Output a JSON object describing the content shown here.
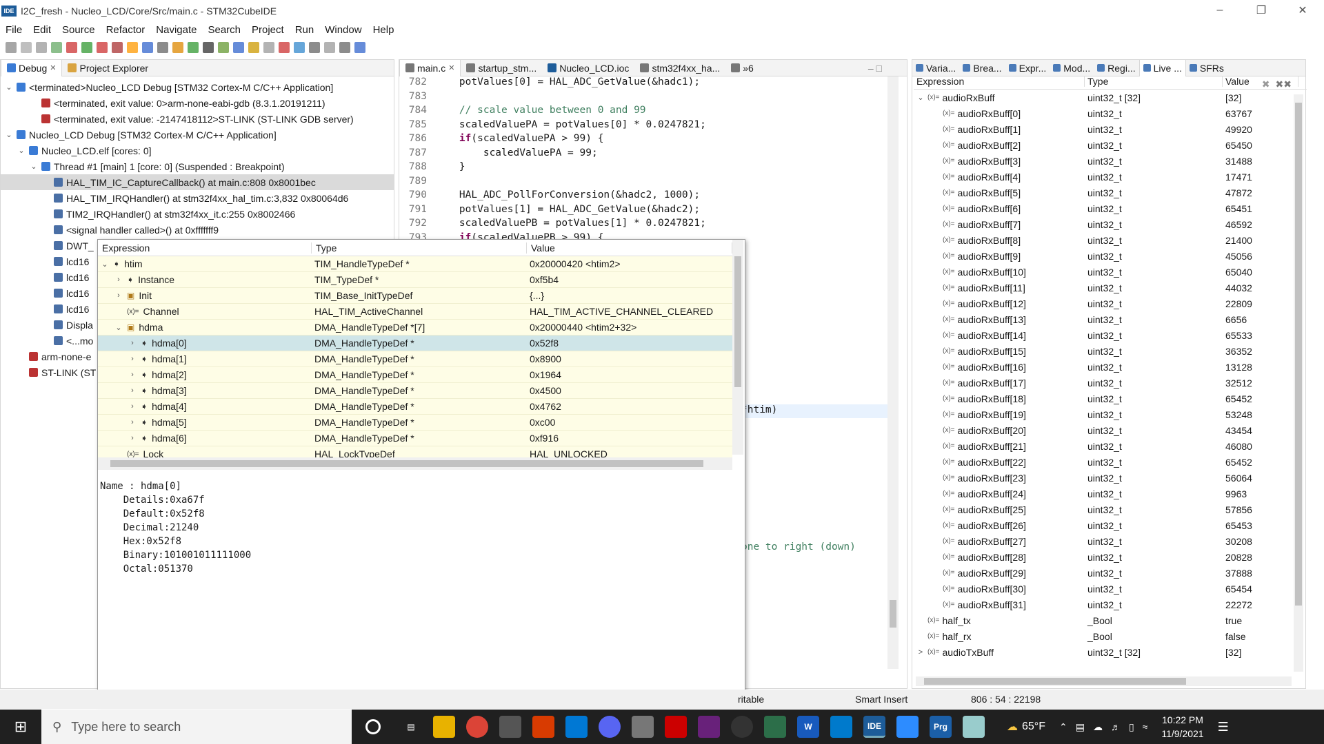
{
  "window": {
    "title": "I2C_fresh - Nucleo_LCD/Core/Src/main.c - STM32CubeIDE",
    "app_icon": "IDE"
  },
  "menu": [
    "File",
    "Edit",
    "Source",
    "Refactor",
    "Navigate",
    "Search",
    "Project",
    "Run",
    "Window",
    "Help"
  ],
  "debug_view": {
    "tabs": [
      "Debug",
      "Project Explorer"
    ],
    "rows": [
      {
        "text": "<terminated>Nucleo_LCD Debug [STM32 Cortex-M C/C++ Application]",
        "indent": 0,
        "caret": "v"
      },
      {
        "text": "<terminated, exit value: 0>arm-none-eabi-gdb (8.3.1.20191211)",
        "indent": 2,
        "caret": ""
      },
      {
        "text": "<terminated, exit value: -2147418112>ST-LINK (ST-LINK GDB server)",
        "indent": 2,
        "caret": ""
      },
      {
        "text": "Nucleo_LCD Debug [STM32 Cortex-M C/C++ Application]",
        "indent": 0,
        "caret": "v"
      },
      {
        "text": "Nucleo_LCD.elf [cores: 0]",
        "indent": 1,
        "caret": "v"
      },
      {
        "text": "Thread #1 [main] 1 [core: 0] (Suspended : Breakpoint)",
        "indent": 2,
        "caret": "v"
      },
      {
        "text": "HAL_TIM_IC_CaptureCallback() at main.c:808 0x8001bec",
        "indent": 3,
        "caret": "",
        "selected": true
      },
      {
        "text": "HAL_TIM_IRQHandler() at stm32f4xx_hal_tim.c:3,832 0x80064d6",
        "indent": 3,
        "caret": ""
      },
      {
        "text": "TIM2_IRQHandler() at stm32f4xx_it.c:255 0x8002466",
        "indent": 3,
        "caret": ""
      },
      {
        "text": "<signal handler called>() at 0xfffffff9",
        "indent": 3,
        "caret": ""
      },
      {
        "text": "DWT_",
        "indent": 3,
        "caret": ""
      },
      {
        "text": "lcd16",
        "indent": 3,
        "caret": ""
      },
      {
        "text": "lcd16",
        "indent": 3,
        "caret": ""
      },
      {
        "text": "lcd16",
        "indent": 3,
        "caret": ""
      },
      {
        "text": "lcd16",
        "indent": 3,
        "caret": ""
      },
      {
        "text": "Displa",
        "indent": 3,
        "caret": ""
      },
      {
        "text": "<...mo",
        "indent": 3,
        "caret": ""
      },
      {
        "text": "arm-none-e",
        "indent": 1,
        "caret": ""
      },
      {
        "text": "ST-LINK (ST",
        "indent": 1,
        "caret": ""
      }
    ]
  },
  "editor": {
    "tabs": [
      "main.c",
      "startup_stm...",
      "Nucleo_LCD.ioc",
      "stm32f4xx_ha...",
      "»6"
    ],
    "lines": [
      {
        "n": "782",
        "t": "    potValues[0] = HAL_ADC_GetValue(&hadc1);"
      },
      {
        "n": "783",
        "t": ""
      },
      {
        "n": "784",
        "t": "    // scale value between 0 and 99",
        "c": true
      },
      {
        "n": "785",
        "t": "    scaledValuePA = potValues[0] * 0.0247821;"
      },
      {
        "n": "786",
        "t": "    if(scaledValuePA > 99) {",
        "k": "if"
      },
      {
        "n": "787",
        "t": "        scaledValuePA = 99;"
      },
      {
        "n": "788",
        "t": "    }"
      },
      {
        "n": "789",
        "t": ""
      },
      {
        "n": "790",
        "t": "    HAL_ADC_PollForConversion(&hadc2, 1000);"
      },
      {
        "n": "791",
        "t": "    potValues[1] = HAL_ADC_GetValue(&hadc2);"
      },
      {
        "n": "792",
        "t": "    scaledValuePB = potValues[1] * 0.0247821;"
      },
      {
        "n": "793",
        "t": "    if(scaledValuePB > 99) {",
        "k": "if"
      }
    ],
    "frag1": "*htim)",
    "frag2": "one to right (down)"
  },
  "hover": {
    "headers": [
      "Expression",
      "Type",
      "Value"
    ],
    "rows": [
      {
        "name": "htim",
        "type": "TIM_HandleTypeDef *",
        "value": "0x20000420 <htim2>",
        "lvl": 0,
        "caret": "v",
        "icon": "ptr"
      },
      {
        "name": "Instance",
        "type": "TIM_TypeDef *",
        "value": "0xf5b4",
        "lvl": 1,
        "caret": ">",
        "icon": "ptr"
      },
      {
        "name": "Init",
        "type": "TIM_Base_InitTypeDef",
        "value": "{...}",
        "lvl": 1,
        "caret": ">",
        "icon": "struct"
      },
      {
        "name": "Channel",
        "type": "HAL_TIM_ActiveChannel",
        "value": "HAL_TIM_ACTIVE_CHANNEL_CLEARED",
        "lvl": 1,
        "caret": "",
        "icon": "var"
      },
      {
        "name": "hdma",
        "type": "DMA_HandleTypeDef *[7]",
        "value": "0x20000440 <htim2+32>",
        "lvl": 1,
        "caret": "v",
        "icon": "struct"
      },
      {
        "name": "hdma[0]",
        "type": "DMA_HandleTypeDef *",
        "value": "0x52f8",
        "lvl": 2,
        "caret": ">",
        "icon": "ptr",
        "selected": true
      },
      {
        "name": "hdma[1]",
        "type": "DMA_HandleTypeDef *",
        "value": "0x8900",
        "lvl": 2,
        "caret": ">",
        "icon": "ptr"
      },
      {
        "name": "hdma[2]",
        "type": "DMA_HandleTypeDef *",
        "value": "0x1964",
        "lvl": 2,
        "caret": ">",
        "icon": "ptr"
      },
      {
        "name": "hdma[3]",
        "type": "DMA_HandleTypeDef *",
        "value": "0x4500",
        "lvl": 2,
        "caret": ">",
        "icon": "ptr"
      },
      {
        "name": "hdma[4]",
        "type": "DMA_HandleTypeDef *",
        "value": "0x4762",
        "lvl": 2,
        "caret": ">",
        "icon": "ptr"
      },
      {
        "name": "hdma[5]",
        "type": "DMA_HandleTypeDef *",
        "value": "0xc00",
        "lvl": 2,
        "caret": ">",
        "icon": "ptr"
      },
      {
        "name": "hdma[6]",
        "type": "DMA_HandleTypeDef *",
        "value": "0xf916",
        "lvl": 2,
        "caret": ">",
        "icon": "ptr"
      },
      {
        "name": "Lock",
        "type": "HAL_LockTypeDef",
        "value": "HAL_UNLOCKED",
        "lvl": 1,
        "caret": "",
        "icon": "var"
      }
    ],
    "detail": [
      "Name : hdma[0]",
      "    Details:0xa67f",
      "    Default:0x52f8",
      "    Decimal:21240",
      "    Hex:0x52f8",
      "    Binary:101001011111000",
      "    Octal:051370"
    ]
  },
  "expr_view": {
    "tabs": [
      "Varia...",
      "Brea...",
      "Expr...",
      "Mod...",
      "Regi...",
      "Live ...",
      "SFRs"
    ],
    "headers": [
      "Expression",
      "Type",
      "Value"
    ],
    "parent": {
      "name": "audioRxBuff",
      "type": "uint32_t [32]",
      "value": "[32]"
    },
    "items": [
      {
        "name": "audioRxBuff[0]",
        "type": "uint32_t",
        "value": "63767"
      },
      {
        "name": "audioRxBuff[1]",
        "type": "uint32_t",
        "value": "49920"
      },
      {
        "name": "audioRxBuff[2]",
        "type": "uint32_t",
        "value": "65450"
      },
      {
        "name": "audioRxBuff[3]",
        "type": "uint32_t",
        "value": "31488"
      },
      {
        "name": "audioRxBuff[4]",
        "type": "uint32_t",
        "value": "17471"
      },
      {
        "name": "audioRxBuff[5]",
        "type": "uint32_t",
        "value": "47872"
      },
      {
        "name": "audioRxBuff[6]",
        "type": "uint32_t",
        "value": "65451"
      },
      {
        "name": "audioRxBuff[7]",
        "type": "uint32_t",
        "value": "46592"
      },
      {
        "name": "audioRxBuff[8]",
        "type": "uint32_t",
        "value": "21400"
      },
      {
        "name": "audioRxBuff[9]",
        "type": "uint32_t",
        "value": "45056"
      },
      {
        "name": "audioRxBuff[10]",
        "type": "uint32_t",
        "value": "65040"
      },
      {
        "name": "audioRxBuff[11]",
        "type": "uint32_t",
        "value": "44032"
      },
      {
        "name": "audioRxBuff[12]",
        "type": "uint32_t",
        "value": "22809"
      },
      {
        "name": "audioRxBuff[13]",
        "type": "uint32_t",
        "value": "6656"
      },
      {
        "name": "audioRxBuff[14]",
        "type": "uint32_t",
        "value": "65533"
      },
      {
        "name": "audioRxBuff[15]",
        "type": "uint32_t",
        "value": "36352"
      },
      {
        "name": "audioRxBuff[16]",
        "type": "uint32_t",
        "value": "13128"
      },
      {
        "name": "audioRxBuff[17]",
        "type": "uint32_t",
        "value": "32512"
      },
      {
        "name": "audioRxBuff[18]",
        "type": "uint32_t",
        "value": "65452"
      },
      {
        "name": "audioRxBuff[19]",
        "type": "uint32_t",
        "value": "53248"
      },
      {
        "name": "audioRxBuff[20]",
        "type": "uint32_t",
        "value": "43454"
      },
      {
        "name": "audioRxBuff[21]",
        "type": "uint32_t",
        "value": "46080"
      },
      {
        "name": "audioRxBuff[22]",
        "type": "uint32_t",
        "value": "65452"
      },
      {
        "name": "audioRxBuff[23]",
        "type": "uint32_t",
        "value": "56064"
      },
      {
        "name": "audioRxBuff[24]",
        "type": "uint32_t",
        "value": "9963"
      },
      {
        "name": "audioRxBuff[25]",
        "type": "uint32_t",
        "value": "57856"
      },
      {
        "name": "audioRxBuff[26]",
        "type": "uint32_t",
        "value": "65453"
      },
      {
        "name": "audioRxBuff[27]",
        "type": "uint32_t",
        "value": "30208"
      },
      {
        "name": "audioRxBuff[28]",
        "type": "uint32_t",
        "value": "20828"
      },
      {
        "name": "audioRxBuff[29]",
        "type": "uint32_t",
        "value": "37888"
      },
      {
        "name": "audioRxBuff[30]",
        "type": "uint32_t",
        "value": "65454"
      },
      {
        "name": "audioRxBuff[31]",
        "type": "uint32_t",
        "value": "22272"
      }
    ],
    "extra": [
      {
        "name": "half_tx",
        "type": "_Bool",
        "value": "true"
      },
      {
        "name": "half_rx",
        "type": "_Bool",
        "value": "false"
      },
      {
        "name": "audioTxBuff",
        "type": "uint32_t [32]",
        "value": "[32]"
      }
    ]
  },
  "status": {
    "writable": "ritable",
    "mode": "Smart Insert",
    "position": "806 : 54 : 22198"
  },
  "taskbar": {
    "search_placeholder": "Type here to search",
    "weather": "65°F",
    "time": "10:22 PM",
    "date": "11/9/2021"
  }
}
